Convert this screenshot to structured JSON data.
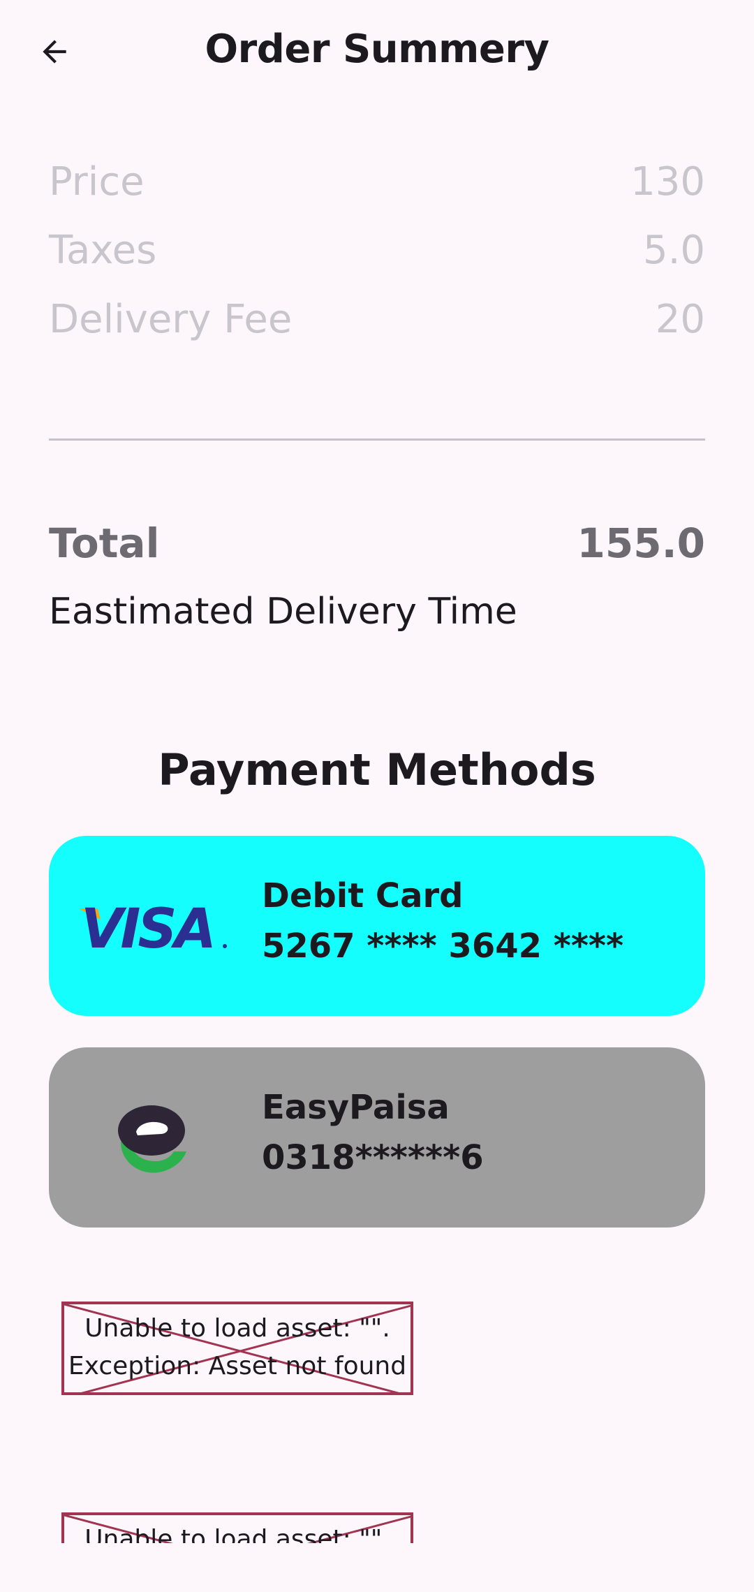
{
  "header": {
    "title": "Order Summery",
    "back_icon": "arrow-left-icon"
  },
  "summary": {
    "items": [
      {
        "label": "Price",
        "value": "130"
      },
      {
        "label": "Taxes",
        "value": "5.0"
      },
      {
        "label": "Delivery Fee",
        "value": "20"
      }
    ],
    "total_label": "Total",
    "total_value": "155.0",
    "eta_label": "Eastimated Delivery Time"
  },
  "payment": {
    "title": "Payment Methods",
    "methods": [
      {
        "name": "Debit Card",
        "detail": "5267 **** 3642 ****",
        "logo": "visa-logo",
        "color": "#14fefe"
      },
      {
        "name": "EasyPaisa",
        "detail": "0318******6",
        "logo": "easypaisa-logo",
        "color": "#9e9e9e"
      }
    ]
  },
  "errors": [
    {
      "line1": "Unable to load asset: \"\".",
      "line2": "Exception: Asset not found"
    },
    {
      "line1": "Unable to load asset: \"\".",
      "line2": ""
    }
  ],
  "colors": {
    "background": "#fdf7fc",
    "error_border": "#a23452"
  }
}
